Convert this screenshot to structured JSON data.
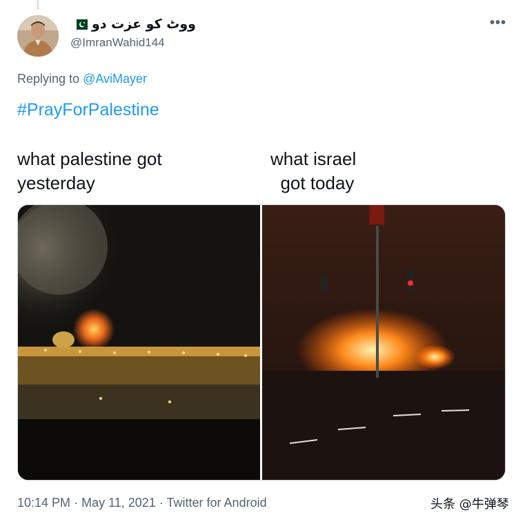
{
  "tweet": {
    "display_name": "ووٹ کو عزت دو",
    "flag_icon": "pakistan-flag-icon",
    "handle": "@ImranWahid144",
    "more_icon": "more-options-icon",
    "replying_prefix": "Replying to",
    "replying_to": "@AviMayer",
    "hashtag": "#PrayForPalestine",
    "caption_left": "what palestine got\nyesterday",
    "caption_right": "what israel\n  got today",
    "time": "10:14 PM",
    "date": "May 11, 2021",
    "source": "Twitter for Android",
    "separator": "·",
    "link_color": "#1d9bf0",
    "muted_color": "#536471"
  },
  "watermark": {
    "text": "头条 @牛弹琴"
  }
}
